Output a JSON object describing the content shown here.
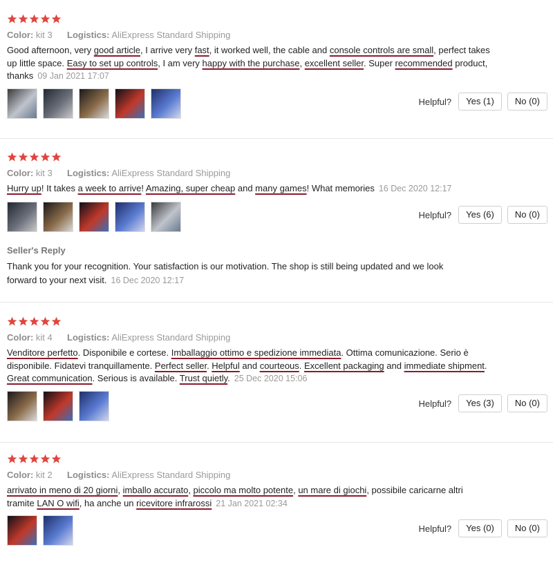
{
  "colors": {
    "star": "#e0463e",
    "underline": "#8b1a2b",
    "muted": "#9a9a9a"
  },
  "labels": {
    "color_key": "Color:",
    "logistics_key": "Logistics:",
    "helpful": "Helpful?",
    "seller_reply": "Seller's Reply"
  },
  "reviews": [
    {
      "rating": 5,
      "color": "kit 3",
      "logistics": "AliExpress Standard Shipping",
      "segments": [
        {
          "t": "Good afternoon, very ",
          "u": false
        },
        {
          "t": "good article",
          "u": true
        },
        {
          "t": ", I arrive very ",
          "u": false
        },
        {
          "t": "fast",
          "u": true
        },
        {
          "t": ", it worked well, the cable and ",
          "u": false
        },
        {
          "t": "console controls are small",
          "u": true
        },
        {
          "t": ", perfect takes up little space. ",
          "u": false
        },
        {
          "t": "Easy to set up controls",
          "u": true
        },
        {
          "t": ", I am very ",
          "u": false
        },
        {
          "t": "happy with the purchase",
          "u": true
        },
        {
          "t": ", ",
          "u": false
        },
        {
          "t": "excellent seller",
          "u": true
        },
        {
          "t": ". Super ",
          "u": false
        },
        {
          "t": "recommended",
          "u": true
        },
        {
          "t": " product, thanks",
          "u": false
        }
      ],
      "date": "09 Jan 2021 17:07",
      "thumbs": 5,
      "yes": "Yes (1)",
      "no": "No (0)"
    },
    {
      "rating": 5,
      "color": "kit 3",
      "logistics": "AliExpress Standard Shipping",
      "segments": [
        {
          "t": "Hurry up",
          "u": true
        },
        {
          "t": "! It takes ",
          "u": false
        },
        {
          "t": "a week to arrive",
          "u": true
        },
        {
          "t": "! ",
          "u": false
        },
        {
          "t": "Amazing, super cheap",
          "u": true
        },
        {
          "t": " and ",
          "u": false
        },
        {
          "t": "many games",
          "u": true
        },
        {
          "t": "! What memories",
          "u": false
        }
      ],
      "date": "16 Dec 2020 12:17",
      "thumbs": 5,
      "yes": "Yes (6)",
      "no": "No (0)",
      "reply": {
        "text": "Thank you for your recognition. Your satisfaction is our motivation. The shop is still being updated and we look forward to your next visit.",
        "date": "16 Dec 2020 12:17"
      }
    },
    {
      "rating": 5,
      "color": "kit 4",
      "logistics": "AliExpress Standard Shipping",
      "segments": [
        {
          "t": "Venditore perfetto",
          "u": true
        },
        {
          "t": ". Disponibile e cortese. ",
          "u": false
        },
        {
          "t": "Imballaggio ottimo e spedizione immediata",
          "u": true
        },
        {
          "t": ". Ottima comunicazione. Serio è disponibile. Fidatevi tranquillamente. ",
          "u": false
        },
        {
          "t": "Perfect seller",
          "u": true
        },
        {
          "t": ". ",
          "u": false
        },
        {
          "t": "Helpful",
          "u": true
        },
        {
          "t": " and ",
          "u": false
        },
        {
          "t": "courteous",
          "u": true
        },
        {
          "t": ". ",
          "u": false
        },
        {
          "t": "Excellent packaging",
          "u": true
        },
        {
          "t": " and ",
          "u": false
        },
        {
          "t": "immediate shipment",
          "u": true
        },
        {
          "t": ". ",
          "u": false
        },
        {
          "t": "Great communication",
          "u": true
        },
        {
          "t": ". Serious is available. ",
          "u": false
        },
        {
          "t": "Trust quietly",
          "u": true
        },
        {
          "t": ".",
          "u": false
        }
      ],
      "date": "25 Dec 2020 15:06",
      "thumbs": 3,
      "yes": "Yes (3)",
      "no": "No (0)"
    },
    {
      "rating": 5,
      "color": "kit 2",
      "logistics": "AliExpress Standard Shipping",
      "segments": [
        {
          "t": "arrivato in meno di 20 giorni",
          "u": true
        },
        {
          "t": ", ",
          "u": false
        },
        {
          "t": "imballo accurato",
          "u": true
        },
        {
          "t": ", ",
          "u": false
        },
        {
          "t": "piccolo ma molto potente",
          "u": true
        },
        {
          "t": ", ",
          "u": false
        },
        {
          "t": "un mare di giochi",
          "u": true
        },
        {
          "t": ", possibile caricarne altri tramite ",
          "u": false
        },
        {
          "t": "LAN O wifi",
          "u": true
        },
        {
          "t": ", ha anche un ",
          "u": false
        },
        {
          "t": "ricevitore infrarossi",
          "u": true
        }
      ],
      "date": "21 Jan 2021 02:34",
      "thumbs": 2,
      "yes": "Yes (0)",
      "no": "No (0)"
    }
  ]
}
